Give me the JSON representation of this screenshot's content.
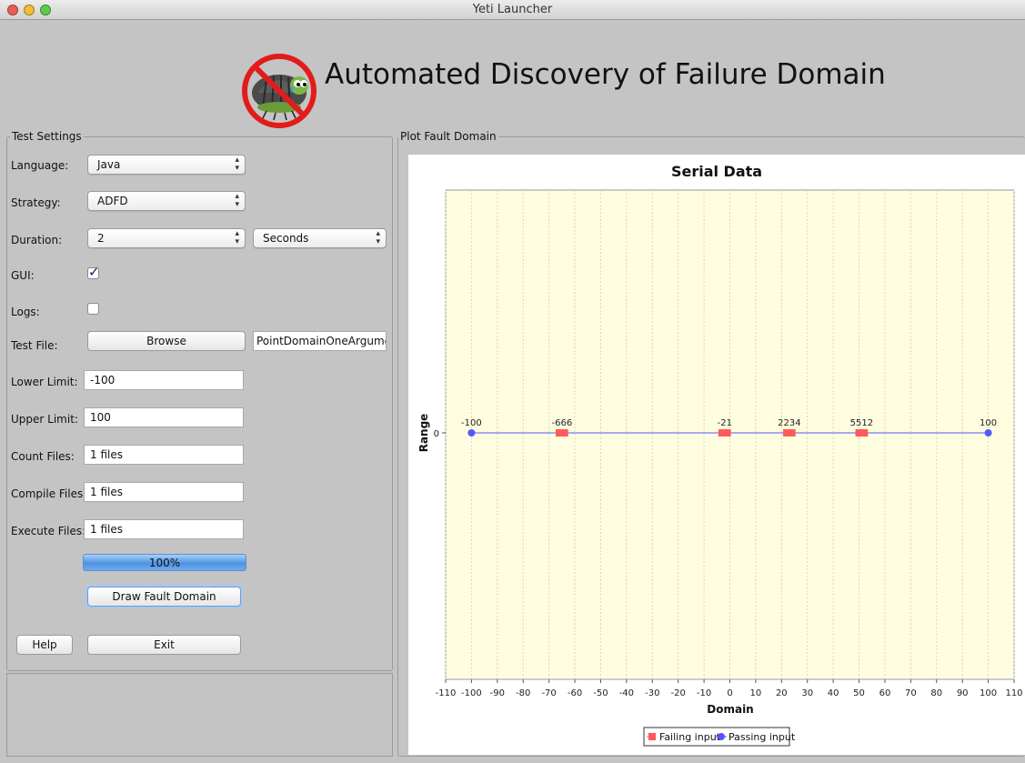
{
  "window": {
    "title": "Yeti Launcher"
  },
  "banner": {
    "title": "Automated Discovery of Failure Domain",
    "logo_icon": "crossed-out-bug-logo"
  },
  "settings": {
    "group_title": "Test Settings",
    "language": {
      "label": "Language:",
      "value": "Java"
    },
    "strategy": {
      "label": "Strategy:",
      "value": "ADFD"
    },
    "duration": {
      "label": "Duration:",
      "value": "2",
      "unit": "Seconds"
    },
    "gui": {
      "label": "GUI:",
      "checked": true
    },
    "logs": {
      "label": "Logs:",
      "checked": false
    },
    "test_file": {
      "label": "Test File:",
      "browse_label": "Browse",
      "value": "PointDomainOneArgument"
    },
    "lower_limit": {
      "label": "Lower Limit:",
      "value": "-100"
    },
    "upper_limit": {
      "label": "Upper Limit:",
      "value": "100"
    },
    "count_files": {
      "label": "Count Files:",
      "value": "1 files"
    },
    "compile_files": {
      "label": "Compile Files:",
      "value": "1 files"
    },
    "execute_files": {
      "label": "Execute Files:",
      "value": "1 files"
    },
    "progress": {
      "value": 100,
      "label": "100%"
    },
    "draw_button": "Draw Fault Domain",
    "help_button": "Help",
    "exit_button": "Exit"
  },
  "plot": {
    "group_title": "Plot Fault Domain"
  },
  "chart_data": {
    "type": "scatter",
    "title": "Serial Data",
    "xlabel": "Domain",
    "ylabel": "Range",
    "xlim": [
      -110,
      110
    ],
    "x_ticks": [
      "-110",
      "-100",
      "-90",
      "-80",
      "-70",
      "-60",
      "-50",
      "-40",
      "-30",
      "-20",
      "-10",
      "0",
      "10",
      "20",
      "30",
      "40",
      "50",
      "60",
      "70",
      "80",
      "90",
      "100",
      "110"
    ],
    "y_ticks": [
      "0"
    ],
    "grid": true,
    "legend_position": "bottom",
    "series": [
      {
        "name": "Failing input",
        "color": "#ff5a5a",
        "marker": "square",
        "points": [
          {
            "x": -66,
            "y": 0
          },
          {
            "x": -65,
            "y": 0
          },
          {
            "x": -64,
            "y": 0
          },
          {
            "x": -3,
            "y": 0
          },
          {
            "x": -2,
            "y": 0
          },
          {
            "x": -1,
            "y": 0
          },
          {
            "x": 22,
            "y": 0
          },
          {
            "x": 23,
            "y": 0
          },
          {
            "x": 24,
            "y": 0
          },
          {
            "x": 50,
            "y": 0
          },
          {
            "x": 51,
            "y": 0
          },
          {
            "x": 52,
            "y": 0
          }
        ]
      },
      {
        "name": "Passing input",
        "color": "#5555ff",
        "marker": "circle",
        "points": [
          {
            "x": -100,
            "y": 0
          },
          {
            "x": 100,
            "y": 0
          }
        ]
      }
    ],
    "point_labels": [
      {
        "x": -100,
        "text": "-100"
      },
      {
        "x": -65,
        "text": "-666"
      },
      {
        "x": -2,
        "text": "-21"
      },
      {
        "x": 23,
        "text": "2234"
      },
      {
        "x": 51,
        "text": "5512"
      },
      {
        "x": 100,
        "text": "100"
      }
    ]
  }
}
